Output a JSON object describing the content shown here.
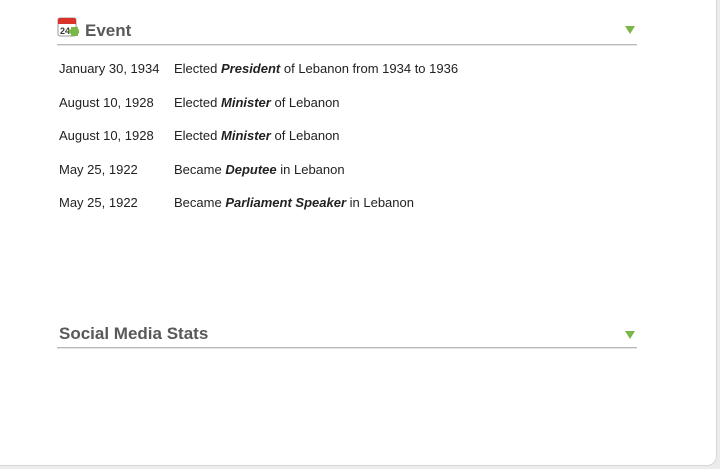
{
  "event_section": {
    "title": "Event",
    "calendar_icon_label": "24",
    "items": [
      {
        "date": "January 30, 1934",
        "prefix": "Elected",
        "role": "President",
        "suffix": "of Lebanon from 1934 to 1936"
      },
      {
        "date": "August 10, 1928",
        "prefix": "Elected",
        "role": "Minister",
        "suffix": "of Lebanon"
      },
      {
        "date": "August 10, 1928",
        "prefix": "Elected",
        "role": "Minister",
        "suffix": "of Lebanon"
      },
      {
        "date": "May 25, 1922",
        "prefix": "Became",
        "role": "Deputee",
        "suffix": "in Lebanon"
      },
      {
        "date": "May 25, 1922",
        "prefix": "Became",
        "role": "Parliament Speaker",
        "suffix": "in Lebanon"
      }
    ]
  },
  "social_section": {
    "title": "Social Media Stats"
  },
  "colors": {
    "accent_green": "#7ab648",
    "title_gray": "#595959",
    "calendar_red": "#d9332b"
  },
  "icons": [
    "calendar-add-icon",
    "collapse-arrow-icon"
  ]
}
